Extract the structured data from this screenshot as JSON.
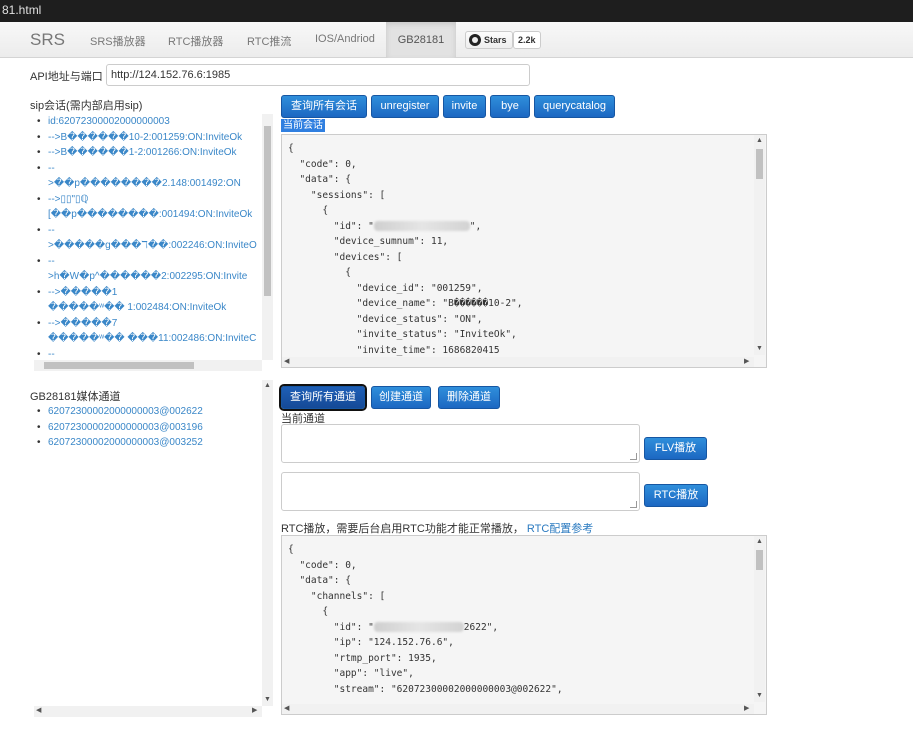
{
  "window": {
    "title": "81.html"
  },
  "nav": {
    "brand": "SRS",
    "items": [
      "SRS播放器",
      "RTC播放器",
      "RTC推流",
      "IOS/Andriod"
    ],
    "active": "GB28181",
    "github": {
      "label": "Stars",
      "count": "2.2k"
    }
  },
  "api": {
    "label": "API地址与端口",
    "value": "http://124.152.76.6:1985"
  },
  "sip": {
    "title": "sip会话(需内部启用sip)",
    "items": [
      [
        "id:62072300002000000003"
      ],
      [
        "-->B������10-2:001259:ON:InviteOk"
      ],
      [
        "-->B������1-2:001266:ON:InviteOk"
      ],
      [
        "--",
        ">��p��������2.148:001492:ON"
      ],
      [
        "-->▯▯\"▯ℚ",
        "[��p��������:001494:ON:InviteOk"
      ],
      [
        "--",
        ">�����g���ℸ��:002246:ON:InviteO"
      ],
      [
        "--",
        ">h�W�p^������2:002295:ON:Invite"
      ],
      [
        "-->�����1",
        "�����ʷ�� 1:002484:ON:InviteOk"
      ],
      [
        "-->�����7",
        "�����ʷ�� ���11:002486:ON:InviteC"
      ],
      [
        "--"
      ]
    ],
    "buttons": [
      "查询所有会话",
      "unregister",
      "invite",
      "bye",
      "querycatalog"
    ],
    "current_label": "当前会话",
    "json": {
      "l1": "{",
      "l2": "  \"code\": 0,",
      "l3": "  \"data\": {",
      "l4": "    \"sessions\": [",
      "l5": "      {",
      "l6a": "        \"id\": \"",
      "l6b": "\",",
      "l7": "        \"device_sumnum\": 11,",
      "l8": "        \"devices\": [",
      "l9": "          {",
      "l10": "            \"device_id\": \"001259\",",
      "l11": "            \"device_name\": \"B������10-2\",",
      "l12": "            \"device_status\": \"ON\",",
      "l13": "            \"invite_status\": \"InviteOk\",",
      "l14": "            \"invite_time\": 1686820415"
    }
  },
  "gb": {
    "title": "GB28181媒体通道",
    "items": [
      "62072300002000000003@002622",
      "62072300002000000003@003196",
      "62072300002000000003@003252"
    ],
    "buttons": [
      "查询所有通道",
      "创建通道",
      "删除通道"
    ],
    "current_label": "当前通道",
    "flv_button": "FLV播放",
    "rtc_button": "RTC播放",
    "rtc_note": "RTC播放，需要后台启用RTC功能才能正常播放，",
    "rtc_link": "RTC配置参考",
    "json": {
      "l1": "{",
      "l2": "  \"code\": 0,",
      "l3": "  \"data\": {",
      "l4": "    \"channels\": [",
      "l5": "      {",
      "l6a": "        \"id\": \"",
      "l6b": "2622\",",
      "l7": "        \"ip\": \"124.152.76.6\",",
      "l8": "        \"rtmp_port\": 1935,",
      "l9": "        \"app\": \"live\",",
      "l10": "        \"stream\": \"62072300002000000003@002622\","
    }
  }
}
